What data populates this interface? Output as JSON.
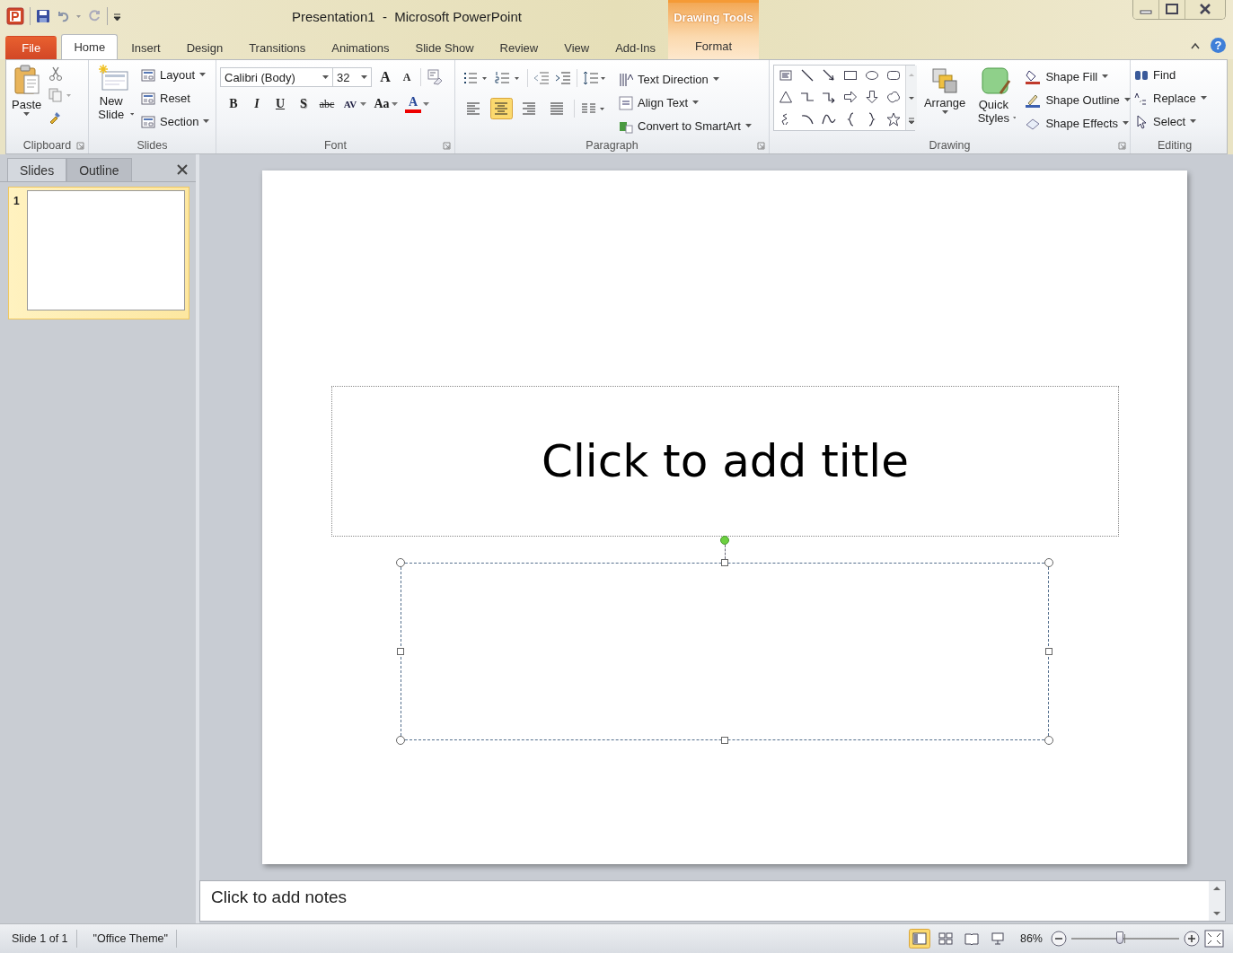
{
  "window": {
    "title": "Presentation1  -  Microsoft PowerPoint",
    "context_label": "Drawing Tools",
    "help": "?"
  },
  "tabs": [
    {
      "label": "File",
      "kind": "file",
      "selected": false
    },
    {
      "label": "Home",
      "kind": "normal",
      "selected": true
    },
    {
      "label": "Insert",
      "kind": "normal",
      "selected": false
    },
    {
      "label": "Design",
      "kind": "normal",
      "selected": false
    },
    {
      "label": "Transitions",
      "kind": "normal",
      "selected": false
    },
    {
      "label": "Animations",
      "kind": "normal",
      "selected": false
    },
    {
      "label": "Slide Show",
      "kind": "normal",
      "selected": false
    },
    {
      "label": "Review",
      "kind": "normal",
      "selected": false
    },
    {
      "label": "View",
      "kind": "normal",
      "selected": false
    },
    {
      "label": "Add-Ins",
      "kind": "normal",
      "selected": false
    },
    {
      "label": "Format",
      "kind": "contextual",
      "selected": false
    }
  ],
  "ribbon": {
    "clipboard": {
      "label": "Clipboard",
      "paste": "Paste"
    },
    "slides": {
      "label": "Slides",
      "new_slide": "New Slide",
      "items": [
        {
          "label": "Layout",
          "dropdown": true
        },
        {
          "label": "Reset",
          "dropdown": false
        },
        {
          "label": "Section",
          "dropdown": true
        }
      ]
    },
    "font": {
      "label": "Font",
      "font_name": "Calibri (Body)",
      "font_size": "32",
      "size_buttons": [
        "A",
        "A"
      ],
      "format_buttons": [
        {
          "label": "B",
          "dropdown": false
        },
        {
          "label": "I",
          "dropdown": false
        },
        {
          "label": "U",
          "dropdown": false
        },
        {
          "label": "S",
          "dropdown": false
        },
        {
          "label": "abc",
          "dropdown": false
        },
        {
          "label": "AV",
          "dropdown": true
        },
        {
          "label": "Aa",
          "dropdown": true
        },
        {
          "label": "A",
          "dropdown": true
        }
      ]
    },
    "paragraph": {
      "label": "Paragraph",
      "alignments": [
        {
          "selected": false
        },
        {
          "selected": true
        },
        {
          "selected": false
        },
        {
          "selected": false
        }
      ],
      "commands": [
        {
          "label": "Text Direction",
          "dropdown": true
        },
        {
          "label": "Align Text",
          "dropdown": true
        },
        {
          "label": "Convert to SmartArt",
          "dropdown": true
        }
      ]
    },
    "drawing": {
      "label": "Drawing",
      "arrange": "Arrange",
      "quick_styles": "Quick Styles",
      "commands": [
        {
          "label": "Shape Fill",
          "dropdown": true
        },
        {
          "label": "Shape Outline",
          "dropdown": true
        },
        {
          "label": "Shape Effects",
          "dropdown": true
        }
      ]
    },
    "editing": {
      "label": "Editing",
      "commands": [
        {
          "label": "Find",
          "dropdown": false
        },
        {
          "label": "Replace",
          "dropdown": true
        },
        {
          "label": "Select",
          "dropdown": true
        }
      ]
    }
  },
  "slides_pane": {
    "tabs": [
      {
        "label": "Slides",
        "selected": true
      },
      {
        "label": "Outline",
        "selected": false
      }
    ],
    "thumbnails": [
      {
        "number": "1",
        "selected": true
      }
    ]
  },
  "slide": {
    "placeholders": [
      {
        "kind": "title",
        "text": "Click to add title",
        "selected": false
      },
      {
        "kind": "subtitle",
        "selected": true
      }
    ]
  },
  "notes": {
    "placeholder": "Click to add notes"
  },
  "status_bar": {
    "slide": "Slide 1 of 1",
    "theme": "\"Office Theme\"",
    "views": [
      {
        "selected": true
      },
      {
        "selected": false
      },
      {
        "selected": false
      },
      {
        "selected": false
      }
    ],
    "zoom": "86%",
    "zoom_slider": {
      "level": 0.45
    }
  }
}
